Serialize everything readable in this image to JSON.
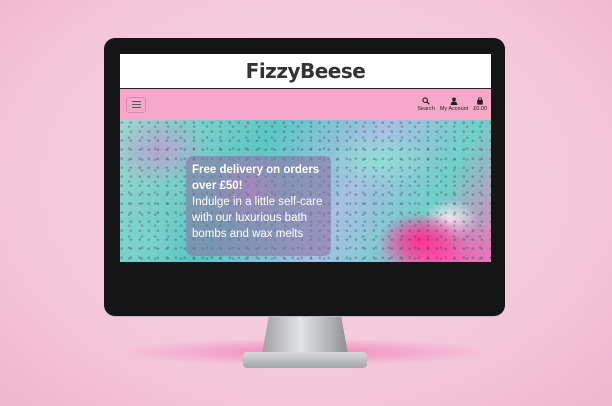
{
  "site": {
    "logo": "FizzyBeese"
  },
  "navbar": {
    "items": [
      {
        "label": "Search",
        "icon": "search-icon"
      },
      {
        "label": "My Account",
        "icon": "user-icon"
      },
      {
        "label": "£0.00",
        "icon": "shopping-bag-icon"
      }
    ]
  },
  "hero": {
    "headline_line1": "Free delivery on orders",
    "headline_line2": "over £50!",
    "body_line1": "Indulge in a little self-care",
    "body_line2": "with our luxurious bath",
    "body_line3": "bombs and wax melts"
  },
  "colors": {
    "navbar": "#f7a8c8",
    "background": "#f3c4d8",
    "hero_accent": "#ff2f8f"
  }
}
